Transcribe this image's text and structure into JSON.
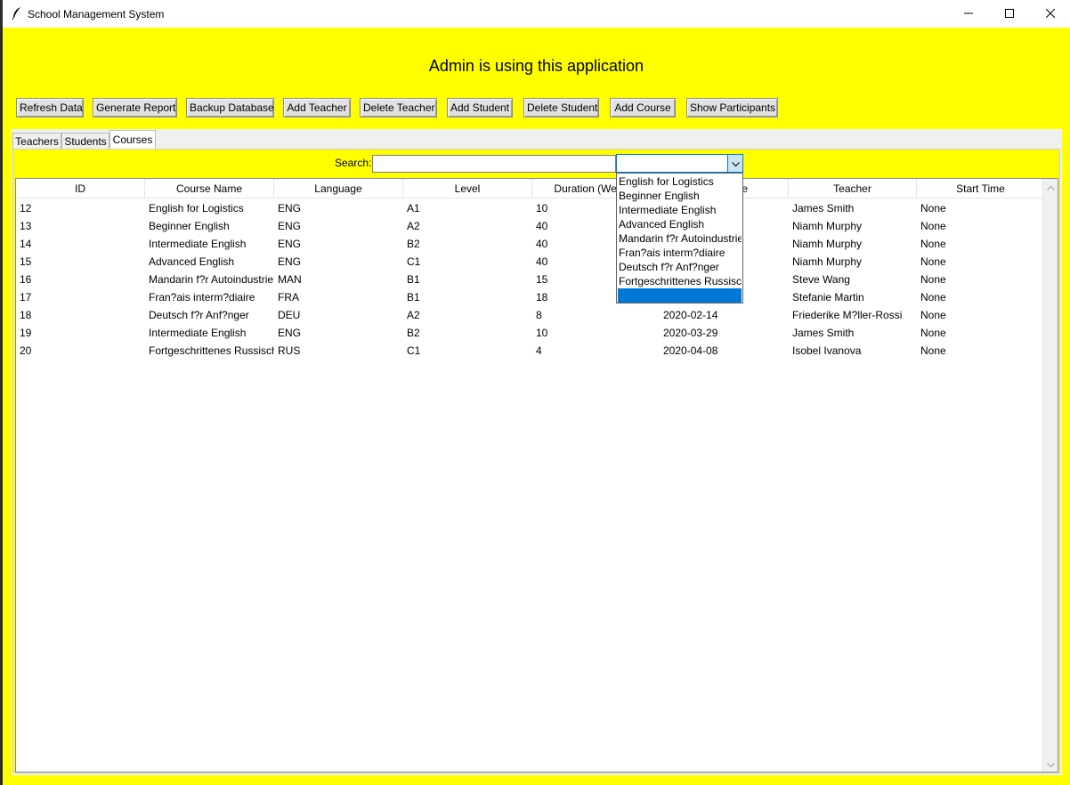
{
  "window": {
    "title": "School Management System"
  },
  "headline": "Admin is using this application",
  "toolbar": {
    "refresh": "Refresh Data",
    "report": "Generate Report",
    "backup": "Backup Database",
    "add_teacher": "Add Teacher",
    "delete_teacher": "Delete Teacher",
    "add_student": "Add Student",
    "delete_student": "Delete Student",
    "add_course": "Add Course",
    "show_participants": "Show Participants"
  },
  "tabs": {
    "teachers": "Teachers",
    "students": "Students",
    "courses": "Courses",
    "active": "Courses"
  },
  "search": {
    "label": "Search:",
    "value": "",
    "combo_value": ""
  },
  "table": {
    "columns": [
      "ID",
      "Course Name",
      "Language",
      "Level",
      "Duration (Weeks)",
      "Start Date",
      "Teacher",
      "Start Time"
    ],
    "rows": [
      [
        "12",
        "English for Logistics",
        "ENG",
        "A1",
        "10",
        "",
        "James Smith",
        "None"
      ],
      [
        "13",
        "Beginner English",
        "ENG",
        "A2",
        "40",
        "",
        "Niamh Murphy",
        "None"
      ],
      [
        "14",
        "Intermediate English",
        "ENG",
        "B2",
        "40",
        "",
        "Niamh Murphy",
        "None"
      ],
      [
        "15",
        "Advanced English",
        "ENG",
        "C1",
        "40",
        "",
        "Niamh Murphy",
        "None"
      ],
      [
        "16",
        "Mandarin f?r Autoindustrie",
        "MAN",
        "B1",
        "15",
        "",
        "Steve Wang",
        "None"
      ],
      [
        "17",
        "Fran?ais interm?diaire",
        "FRA",
        "B1",
        "18",
        "",
        "Stefanie Martin",
        "None"
      ],
      [
        "18",
        "Deutsch f?r Anf?nger",
        "DEU",
        "A2",
        "8",
        "2020-02-14",
        "Friederike M?ller-Rossi",
        "None"
      ],
      [
        "19",
        "Intermediate English",
        "ENG",
        "B2",
        "10",
        "2020-03-29",
        "James Smith",
        "None"
      ],
      [
        "20",
        "Fortgeschrittenes Russisch",
        "RUS",
        "C1",
        "4",
        "2020-04-08",
        "Isobel Ivanova",
        "None"
      ]
    ]
  },
  "dropdown": {
    "options": [
      "English for Logistics",
      "Beginner English",
      "Intermediate English",
      "Advanced English",
      "Mandarin f?r Autoindustrie",
      "Fran?ais interm?diaire",
      "Deutsch f?r Anf?nger",
      "Fortgeschrittenes Russisch",
      ""
    ],
    "selected_index": 8
  },
  "colors": {
    "background": "#ffff00",
    "selection": "#0078d7"
  },
  "icons": {
    "app": "feather-icon",
    "minimize": "minimize-icon",
    "maximize": "maximize-icon",
    "close": "close-icon",
    "combo": "chevron-down-icon"
  }
}
